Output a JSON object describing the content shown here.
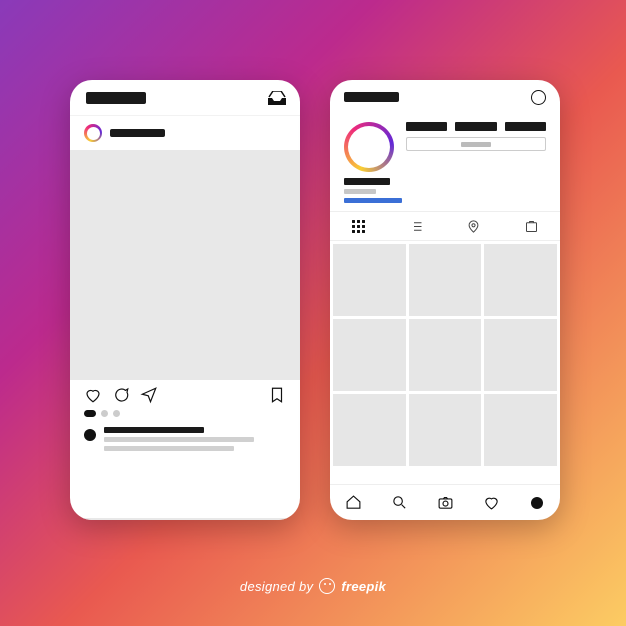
{
  "credit": {
    "prefix": "designed by",
    "brand": "freepik"
  },
  "feed": {
    "pager": {
      "count": 3,
      "activeIndex": 0
    }
  },
  "profile": {
    "stats_count": 3,
    "grid_count": 9,
    "tabs": [
      "grid",
      "list",
      "places",
      "tagged"
    ],
    "nav": [
      "home",
      "search",
      "camera",
      "activity",
      "profile"
    ]
  }
}
